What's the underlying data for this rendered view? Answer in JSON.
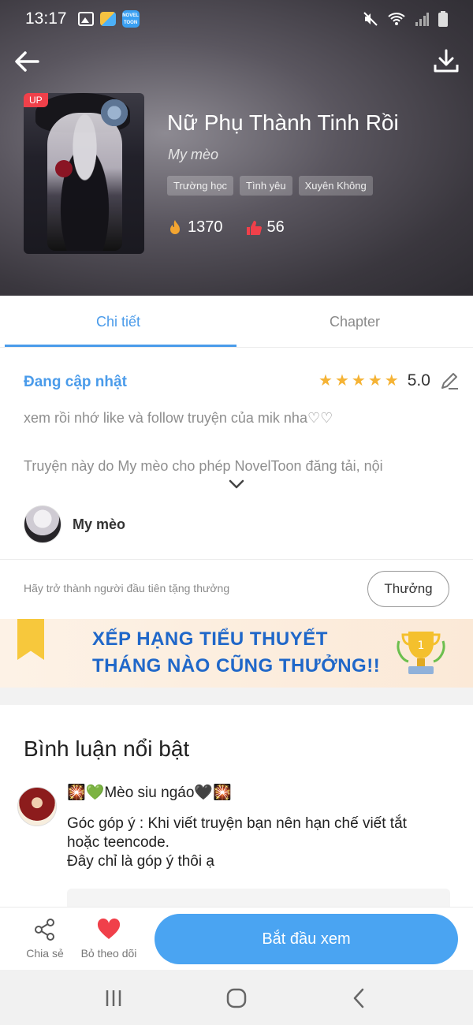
{
  "status_bar": {
    "time": "13:17",
    "novel_icon_text": "NOVEL TOON"
  },
  "header": {
    "up_badge": "UP",
    "title": "Nữ Phụ Thành Tinh Rồi",
    "author": "My mèo",
    "tags": [
      "Trường học",
      "Tình yêu",
      "Xuyên Không"
    ],
    "views": "1370",
    "likes": "56"
  },
  "tabs": {
    "detail": "Chi tiết",
    "chapter": "Chapter"
  },
  "detail": {
    "status": "Đang cập nhật",
    "rating_value": "5.0",
    "rating_stars": 5,
    "description_1": "xem rồi nhớ like và follow truyện của mik nha♡♡",
    "description_2": "Truyện này do My mèo cho phép NovelToon đăng tải, nội",
    "author_name": "My mèo"
  },
  "reward": {
    "prompt": "Hãy trở thành người đầu tiên tặng thưởng",
    "button": "Thưởng"
  },
  "banner": {
    "line1": "XẾP HẠNG TIỂU THUYẾT",
    "line2": "THÁNG NÀO CŨNG THƯỞNG!!"
  },
  "comments": {
    "section_title": "Bình luận nổi bật",
    "items": [
      {
        "user": "🎇💚Mèo siu ngáo🖤🎇",
        "text": "Góc góp ý : Khi viết truyện bạn nên hạn chế viết tắt hoặc teencode.\nĐây chỉ là góp ý thôi ạ"
      }
    ]
  },
  "actions": {
    "share": "Chia sẻ",
    "unfollow": "Bỏ theo dõi",
    "start_reading": "Bắt đầu xem"
  },
  "colors": {
    "accent": "#4a9bea",
    "primary_button": "#4aa4f2",
    "heart": "#f0404a",
    "star": "#f5b335",
    "banner_text": "#1f67c9"
  }
}
